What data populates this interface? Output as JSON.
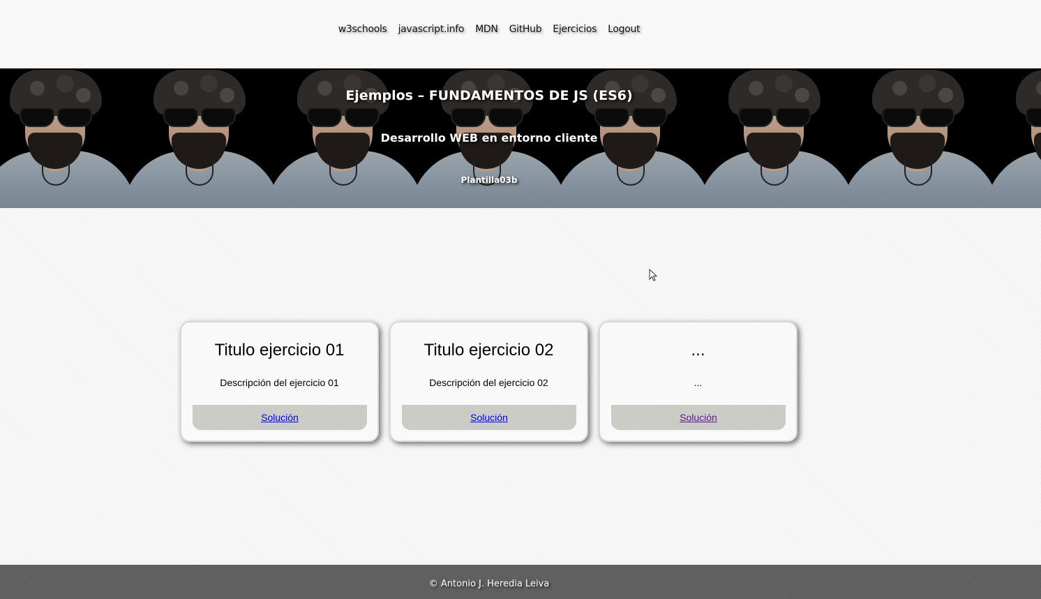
{
  "nav": {
    "links": [
      "w3schools",
      "javascript.info",
      "MDN",
      "GitHub",
      "Ejercicios",
      "Logout"
    ]
  },
  "hero": {
    "title": "Ejemplos – FUNDAMENTOS DE JS (ES6)",
    "subtitle": "Desarrollo WEB en entorno cliente",
    "template": "Plantilla03b",
    "photo_icon": "portrait-photo"
  },
  "cards": [
    {
      "title": "Titulo ejercicio 01",
      "description": "Descripción del ejercicio 01",
      "link": "Solución"
    },
    {
      "title": "Titulo ejercicio 02",
      "description": "Descripción del ejercicio 02",
      "link": "Solución"
    },
    {
      "title": "...",
      "description": "...",
      "link": "Solución"
    }
  ],
  "footer": {
    "text": "© Antonio J. Heredia Leiva"
  },
  "colors": {
    "link": "#0000ee",
    "visited_link": "#551a8b",
    "footer_bg": "#5f5f5f"
  }
}
